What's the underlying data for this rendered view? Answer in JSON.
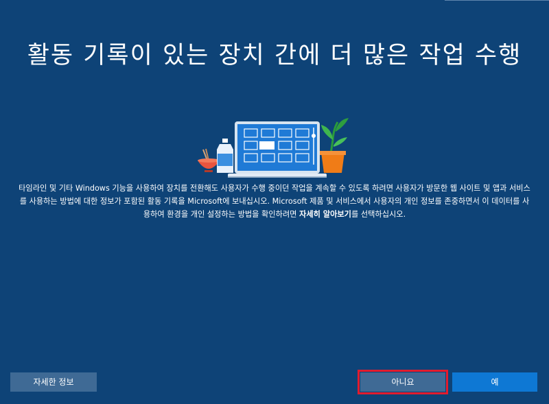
{
  "header": {
    "title": "활동 기록이 있는 장치 간에 더 많은 작업 수행"
  },
  "description": {
    "text_before_link": "타임라인 및 기타 Windows 기능을 사용하여 장치를 전환해도 사용자가 수행 중이던 작업을 계속할 수 있도록 하려면 사용자가 방문한 웹 사이트 및 앱과 서비스를 사용하는 방법에 대한 정보가 포함된 활동 기록을 Microsoft에 보내십시오. Microsoft 제품 및 서비스에서 사용자의 개인 정보를 존중하면서 이 데이터를 사용하여 환경을 개인 설정하는 방법을 확인하려면 ",
    "bold_link": "자세히 알아보기",
    "text_after_link": "를 선택하십시오."
  },
  "buttons": {
    "more_info": "자세한 정보",
    "no": "아니요",
    "yes": "예"
  },
  "colors": {
    "background": "#0e4377",
    "secondary_button": "#3f6a95",
    "primary_button": "#0e78d4",
    "highlight_outline": "#e21c2e"
  }
}
